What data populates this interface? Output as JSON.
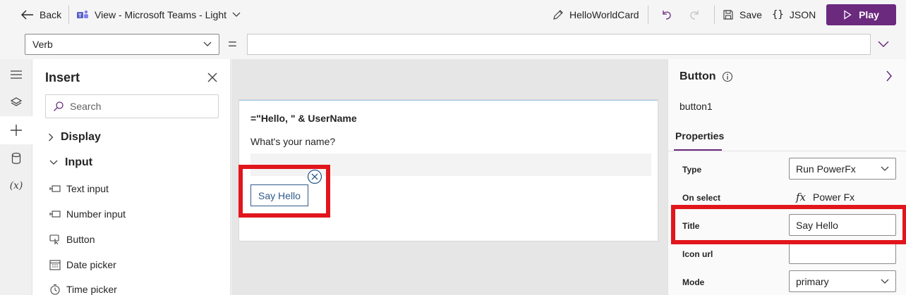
{
  "topbar": {
    "back_label": "Back",
    "view_label": "View - Microsoft Teams - Light",
    "card_name": "HelloWorldCard",
    "save_label": "Save",
    "json_label": "JSON",
    "play_label": "Play",
    "brand_color": "#6b2a7e"
  },
  "formula_bar": {
    "property_select_value": "Verb",
    "equals_sign": "=",
    "formula_value": ""
  },
  "left_rail": {
    "icons": [
      "tree-view-icon",
      "layers-icon",
      "insert-plus-icon",
      "data-source-icon",
      "variables-icon"
    ],
    "variables_glyph": "(x)"
  },
  "insert_panel": {
    "title": "Insert",
    "search_placeholder": "Search",
    "categories": [
      {
        "label": "Display",
        "expanded": false
      },
      {
        "label": "Input",
        "expanded": true
      }
    ],
    "items": [
      {
        "label": "Text input",
        "icon": "text-input-icon"
      },
      {
        "label": "Number input",
        "icon": "number-input-icon"
      },
      {
        "label": "Button",
        "icon": "button-icon"
      },
      {
        "label": "Date picker",
        "icon": "calendar-icon"
      },
      {
        "label": "Time picker",
        "icon": "clock-icon"
      }
    ]
  },
  "canvas": {
    "expression_text": "=\"Hello, \" & UserName",
    "question_text": "What's your name?",
    "input_value": "",
    "button_label": "Say Hello",
    "highlight_color": "#e1161c"
  },
  "properties_panel": {
    "control_type": "Button",
    "control_name": "button1",
    "tab_label": "Properties",
    "rows": {
      "type": {
        "label": "Type",
        "value": "Run PowerFx"
      },
      "on_select": {
        "label": "On select",
        "value": "Power Fx"
      },
      "title": {
        "label": "Title",
        "value": "Say Hello"
      },
      "icon_url": {
        "label": "Icon url",
        "value": ""
      },
      "mode": {
        "label": "Mode",
        "value": "primary"
      }
    }
  }
}
